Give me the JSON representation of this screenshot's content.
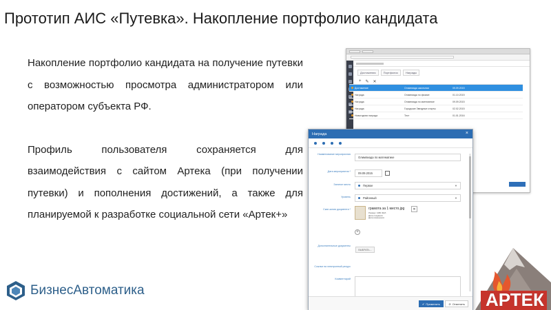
{
  "slide": {
    "title": "Прототип АИС «Путевка». Накопление портфолио кандидата",
    "paragraph1": "Накопление портфолио кандидата на получение путевки с возможностью просмотра администратором или оператором субъекта РФ.",
    "paragraph2": "Профиль пользователя сохраняется для взаимодействия с сайтом Артека (при получении путевки) и пополнения достижений, а также для планируемой к разработке социальной сети «Артек+»"
  },
  "logo": {
    "text": "БизнесАвтоматика"
  },
  "artek_logo": {
    "text": "АРТЕК"
  },
  "back_window": {
    "tabs": [
      "Достижения",
      "Портфолио",
      "Награды"
    ],
    "rows": [
      [
        "Достижение",
        "Олимпиада школьная",
        "09.09.2015"
      ],
      [
        "Награда",
        "Олимпиада по физике",
        "01.10.2015"
      ],
      [
        "Награда",
        "Олимпиада по математике",
        "09.09.2015"
      ],
      [
        "Награда",
        "Городские Звездные старты",
        "02.02.2015"
      ],
      [
        "Новогодняя награда",
        "Тест",
        "01.01.2016"
      ]
    ],
    "selected_row": 0
  },
  "dialog": {
    "title": "Награда",
    "fields": {
      "name_label": "Наименование мероприятия",
      "name_value": "Олимпиада по математике",
      "date_label": "Дата мероприятия *",
      "date_value": "09.09.2015",
      "place_label": "Занятое место",
      "place_value": "Первое",
      "level_label": "Уровень",
      "level_value": "Районный",
      "scan_label": "Скан-копия документа *",
      "attachment_name": "грамота за 1 место.jpg",
      "attachment_meta": [
        "Размер:        1МБ 30кб",
        "Дата создания:",
        "Дата изменения:"
      ],
      "extra_docs_label": "Дополнительные документы",
      "choose_label": "ВЫБРАТЬ...",
      "link_label": "Ссылки на электронный ресурс",
      "comment_label": "Комментарий"
    },
    "buttons": {
      "apply": "Применить",
      "cancel": "Отменить"
    }
  }
}
